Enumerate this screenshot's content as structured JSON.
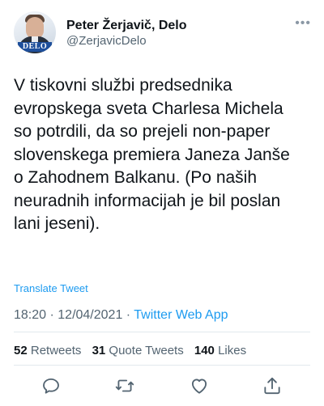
{
  "author": {
    "name": "Peter Žerjavič, Delo",
    "handle": "@ZerjavicDelo",
    "avatar_badge": "DELO"
  },
  "tweet": {
    "text": "V tiskovni službi predsednika\nevropskega sveta Charlesa Michela\nso potrdili, da so prejeli non-paper\nslovenskega premiera Janeza Janše\no Zahodnem Balkanu. (Po naših\nneuradnih informacijah je bil poslan\nlani jeseni).",
    "translate_label": "Translate Tweet",
    "time": "18:20",
    "separator1": " · ",
    "date": "12/04/2021",
    "separator2": " · ",
    "source": "Twitter Web App"
  },
  "stats": {
    "retweets_count": "52",
    "retweets_label": "Retweets",
    "quotes_count": "31",
    "quotes_label": "Quote Tweets",
    "likes_count": "140",
    "likes_label": "Likes"
  },
  "icons": {
    "more": "more-horizontal-icon",
    "reply": "reply-icon",
    "retweet": "retweet-icon",
    "like": "heart-icon",
    "share": "share-icon"
  },
  "colors": {
    "link": "#1d9bf0",
    "text": "#0f1419",
    "muted": "#536471",
    "badge": "#1e4f9b"
  }
}
